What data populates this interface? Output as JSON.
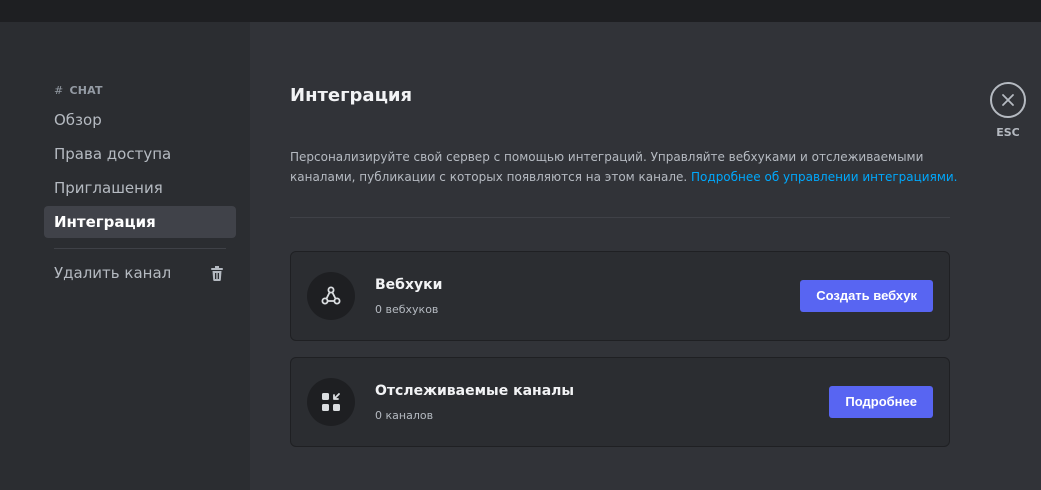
{
  "sidebar": {
    "section_hash": "#",
    "section_title": "CHAT",
    "items": [
      {
        "label": "Обзор"
      },
      {
        "label": "Права доступа"
      },
      {
        "label": "Приглашения"
      },
      {
        "label": "Интеграция"
      }
    ],
    "delete_label": "Удалить канал"
  },
  "main": {
    "title": "Интеграция",
    "description": "Персонализируйте свой сервер с помощью интеграций. Управляйте вебхуками и отслеживаемыми каналами, публикации с которых появляются на этом канале.",
    "learn_more_link": "Подробнее об управлении интеграциями.",
    "cards": [
      {
        "title": "Вебхуки",
        "subtitle": "0 вебхуков",
        "button": "Создать вебхук",
        "icon": "webhook-icon"
      },
      {
        "title": "Отслеживаемые каналы",
        "subtitle": "0 каналов",
        "button": "Подробнее",
        "icon": "followed-channels-icon"
      }
    ]
  },
  "close": {
    "label": "ESC",
    "icon": "close-icon"
  },
  "colors": {
    "accent": "#5865f2",
    "link": "#00a8fc",
    "sidebar_bg": "#2b2d31",
    "main_bg": "#313338",
    "topbar_bg": "#1e1f22"
  }
}
